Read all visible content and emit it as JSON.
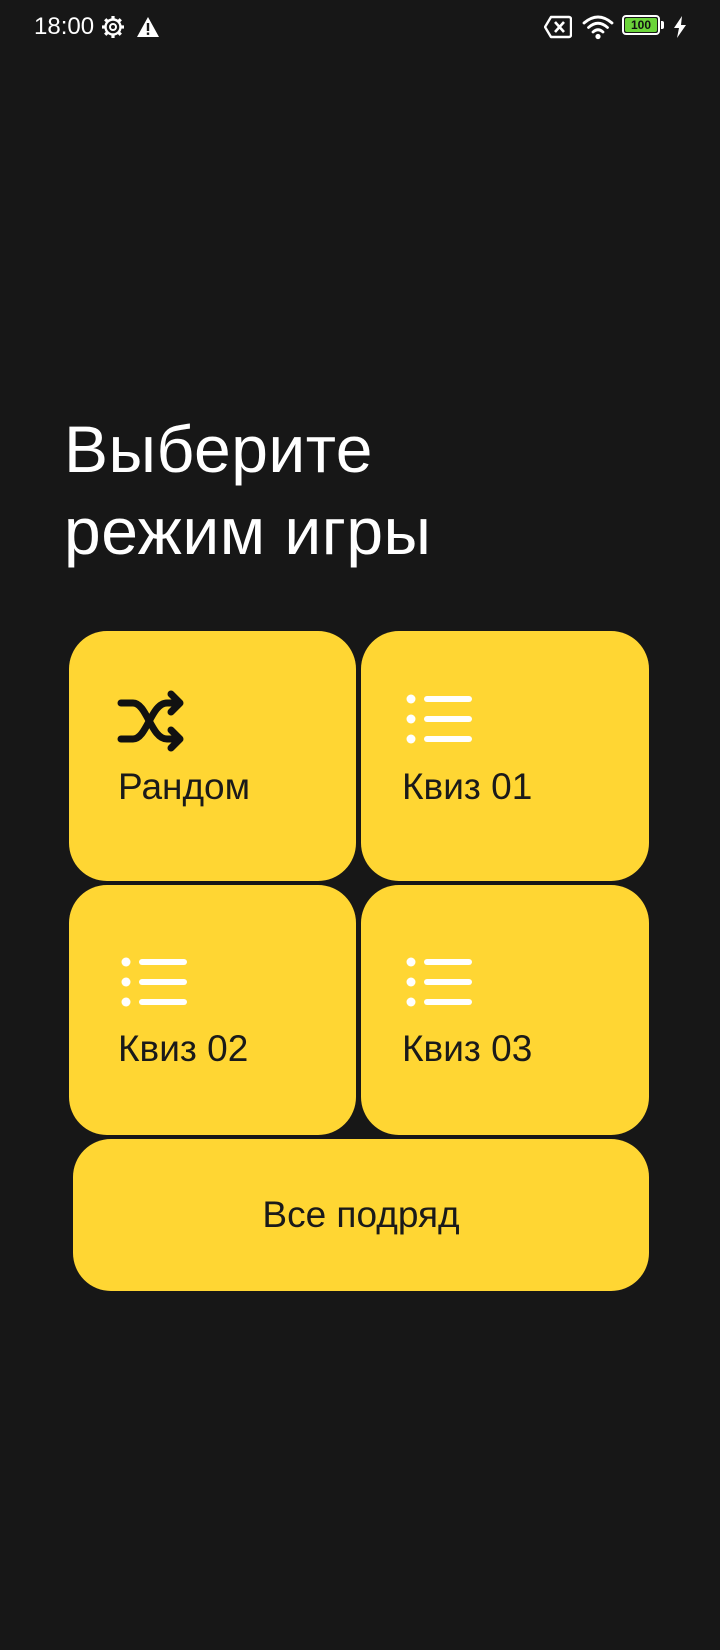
{
  "status_bar": {
    "time": "18:00",
    "battery_level": "100"
  },
  "title": {
    "line1": "Выберите",
    "line2": "режим игры"
  },
  "modes": [
    {
      "label": "Рандом",
      "icon": "shuffle-icon"
    },
    {
      "label": "Квиз 01",
      "icon": "list-icon"
    },
    {
      "label": "Квиз 02",
      "icon": "list-icon"
    },
    {
      "label": "Квиз 03",
      "icon": "list-icon"
    }
  ],
  "all_button": {
    "label": "Все подряд"
  },
  "colors": {
    "background": "#171717",
    "tile": "#FFD633",
    "tile_text": "#1a1a1a",
    "title_text": "#ffffff",
    "battery_fill": "#6BD43A"
  }
}
